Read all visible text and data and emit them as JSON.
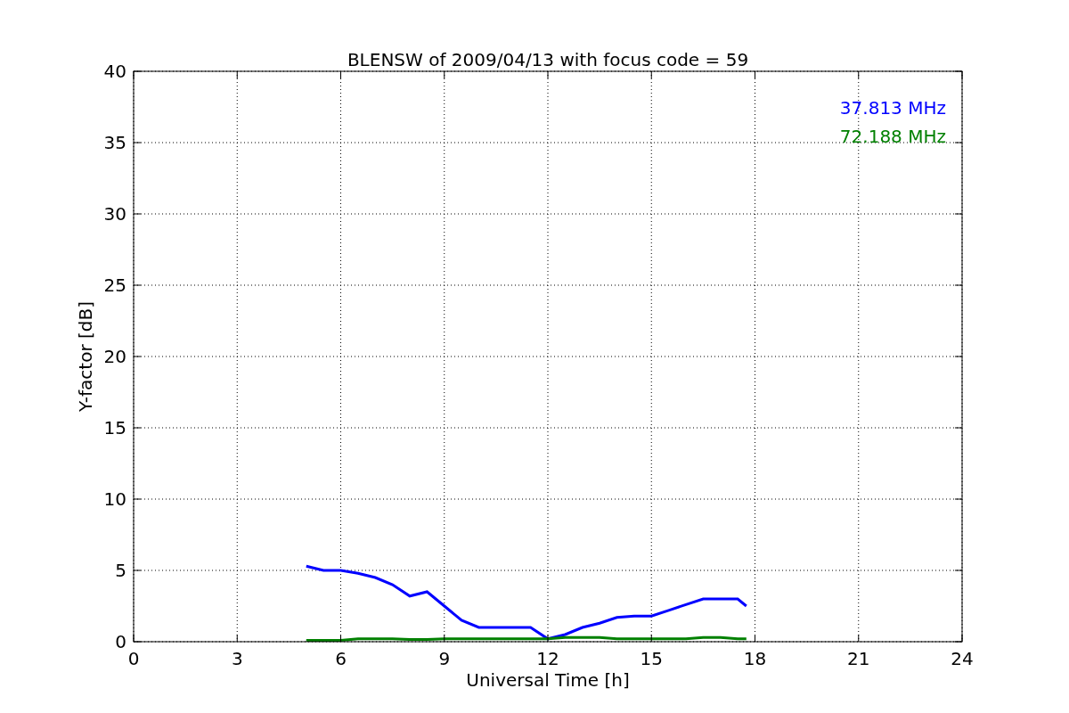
{
  "figure": {
    "chart_data": {
      "type": "line",
      "title": "BLENSW of 2009/04/13 with focus code = 59",
      "xlabel": "Universal Time [h]",
      "ylabel": "Y-factor [dB]",
      "x": [
        5,
        5.5,
        6,
        6.5,
        7,
        7.5,
        8,
        8.5,
        9,
        9.5,
        10,
        10.5,
        11,
        11.5,
        12,
        12.5,
        13,
        13.5,
        14,
        14.5,
        15,
        15.5,
        16,
        16.5,
        17,
        17.5,
        17.75
      ],
      "series": [
        {
          "name": "37.813 MHz",
          "color": "#0000ff",
          "values": [
            5.3,
            5,
            5,
            4.8,
            4.5,
            4,
            3.2,
            3.5,
            2.5,
            1.5,
            1,
            1,
            1,
            1,
            0.2,
            0.5,
            1,
            1.3,
            1.7,
            1.8,
            1.8,
            2.2,
            2.6,
            3,
            3,
            3,
            2.5
          ]
        },
        {
          "name": "72.188 MHz",
          "color": "#008000",
          "values": [
            0.1,
            0.1,
            0.1,
            0.2,
            0.2,
            0.2,
            0.15,
            0.15,
            0.2,
            0.2,
            0.2,
            0.2,
            0.2,
            0.2,
            0.2,
            0.3,
            0.3,
            0.3,
            0.2,
            0.2,
            0.2,
            0.2,
            0.2,
            0.3,
            0.3,
            0.2,
            0.2
          ]
        }
      ],
      "grid": true,
      "xlim": [
        0,
        24
      ],
      "ylim": [
        0,
        40
      ],
      "xticks": [
        0,
        3,
        6,
        9,
        12,
        15,
        18,
        21,
        24
      ],
      "yticks": [
        0,
        5,
        10,
        15,
        20,
        25,
        30,
        35,
        40
      ]
    }
  }
}
